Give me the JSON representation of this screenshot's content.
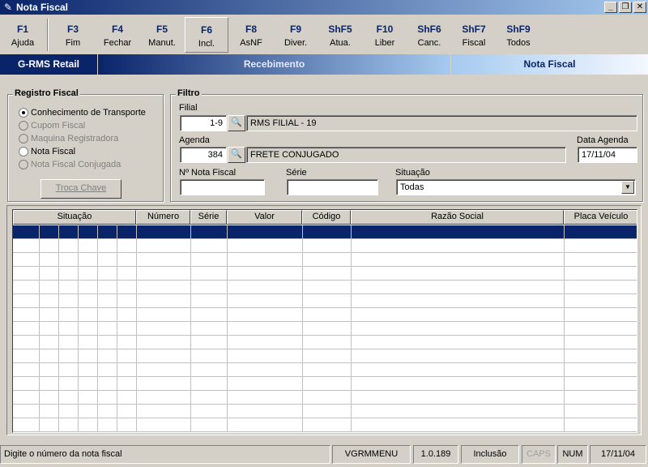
{
  "window": {
    "title": "Nota Fiscal",
    "controls": {
      "minimize": "_",
      "restore": "❐",
      "close": "✕"
    }
  },
  "toolbar": {
    "keys": [
      {
        "key": "F1",
        "label": "Ajuda"
      },
      {
        "key": "F3",
        "label": "Fim"
      },
      {
        "key": "F4",
        "label": "Fechar"
      },
      {
        "key": "F5",
        "label": "Manut."
      },
      {
        "key": "F6",
        "label": "Incl."
      },
      {
        "key": "F8",
        "label": "AsNF"
      },
      {
        "key": "F9",
        "label": "Diver."
      },
      {
        "key": "ShF5",
        "label": "Atua."
      },
      {
        "key": "F10",
        "label": "Liber"
      },
      {
        "key": "ShF6",
        "label": "Canc."
      },
      {
        "key": "ShF7",
        "label": "Fiscal"
      },
      {
        "key": "ShF9",
        "label": "Todos"
      }
    ]
  },
  "banner": {
    "app": "G-RMS Retail",
    "module": "Recebimento",
    "screen": "Nota Fiscal"
  },
  "registro_fiscal": {
    "title": "Registro Fiscal",
    "options": [
      {
        "label": "Conhecimento de Transporte",
        "checked": true,
        "enabled": true
      },
      {
        "label": "Cupom Fiscal",
        "checked": false,
        "enabled": false
      },
      {
        "label": "Maquina Registradora",
        "checked": false,
        "enabled": false
      },
      {
        "label": "Nota Fiscal",
        "checked": false,
        "enabled": true
      },
      {
        "label": "Nota Fiscal Conjugada",
        "checked": false,
        "enabled": false
      }
    ],
    "troca_chave_label": "Troca Chave"
  },
  "filtro": {
    "title": "Filtro",
    "filial_label": "Filial",
    "filial_code": "1-9",
    "filial_name": "RMS FILIAL - 19",
    "agenda_label": "Agenda",
    "agenda_code": "384",
    "agenda_name": "FRETE CONJUGADO",
    "data_agenda_label": "Data Agenda",
    "data_agenda": "17/11/04",
    "nota_label": "Nº Nota Fiscal",
    "nota_value": "",
    "serie_label": "Série",
    "serie_value": "",
    "situacao_label": "Situação",
    "situacao_value": "Todas"
  },
  "grid": {
    "headers": [
      "Situação",
      "Número",
      "Série",
      "Valor",
      "Código",
      "Razão Social",
      "Placa Veículo"
    ],
    "rows": []
  },
  "statusbar": {
    "hint": "Digite o número da nota fiscal",
    "menu": "VGRMMENU",
    "version": "1.0.189",
    "mode": "Inclusão",
    "caps": "CAPS",
    "num": "NUM",
    "date": "17/11/04"
  }
}
